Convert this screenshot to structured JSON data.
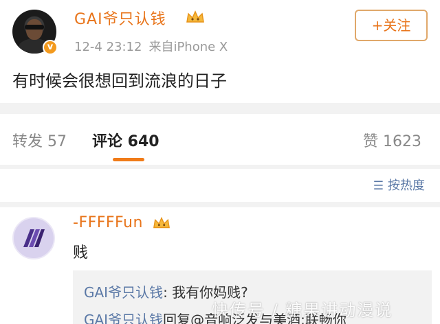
{
  "post": {
    "username": "GAI爷只认钱",
    "time": "12-4 23:12",
    "source": "来自iPhone X",
    "follow_label": "+关注",
    "text": "有时候会很想回到流浪的日子"
  },
  "tabs": [
    {
      "label": "转发 57"
    },
    {
      "label": "评论 640"
    },
    {
      "label": "赞 1623"
    }
  ],
  "sort": {
    "icon": "sort-icon",
    "label": "按热度"
  },
  "comment": {
    "username": "-FFFFFun",
    "text": "贱",
    "replies": [
      {
        "name": "GAI爷只认钱",
        "text": ": 我有你妈贱?"
      },
      {
        "name": "GAI爷只认钱",
        "text": "回复@音响泛发与美酒:联畅你"
      }
    ]
  },
  "watermark": "快传号 / 糖果讲动漫说",
  "colors": {
    "accent": "#e8741a",
    "link": "#5a78a6",
    "background_gap": "#f2f2f2"
  }
}
